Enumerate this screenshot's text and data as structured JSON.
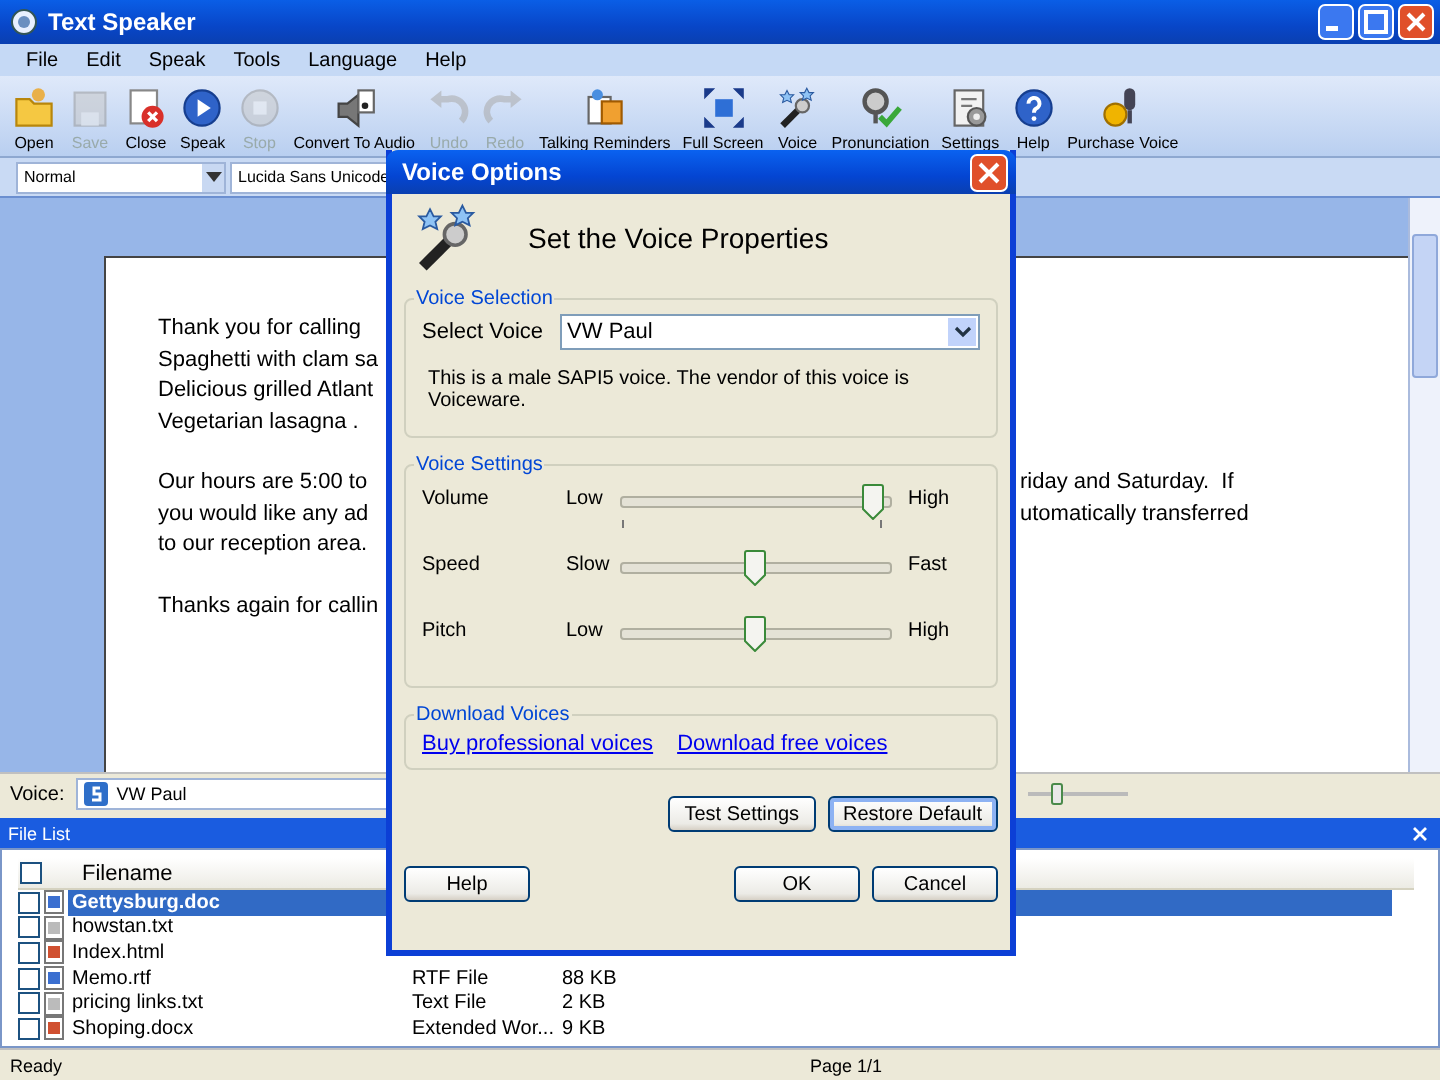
{
  "window": {
    "title": "Text Speaker"
  },
  "menu": [
    "File",
    "Edit",
    "Speak",
    "Tools",
    "Language",
    "Help"
  ],
  "toolbar": [
    {
      "label": "Open",
      "disabled": false
    },
    {
      "label": "Save",
      "disabled": true
    },
    {
      "label": "Close",
      "disabled": false
    },
    {
      "label": "Speak",
      "disabled": false
    },
    {
      "label": "Stop",
      "disabled": true
    },
    {
      "label": "Convert To Audio",
      "disabled": false
    },
    {
      "label": "Undo",
      "disabled": true
    },
    {
      "label": "Redo",
      "disabled": true
    },
    {
      "label": "Talking Reminders",
      "disabled": false
    },
    {
      "label": "Full Screen",
      "disabled": false
    },
    {
      "label": "Voice",
      "disabled": false
    },
    {
      "label": "Pronunciation",
      "disabled": false
    },
    {
      "label": "Settings",
      "disabled": false
    },
    {
      "label": "Help",
      "disabled": false
    },
    {
      "label": "Purchase Voice",
      "disabled": false
    }
  ],
  "format_bar": {
    "style": "Normal",
    "font": "Lucida Sans Unicode"
  },
  "document": {
    "paragraphs": [
      [
        {
          "left": "Thank you for calling"
        },
        {
          "left": "Spaghetti with clam sa"
        },
        {
          "left": "Delicious grilled Atlant"
        },
        {
          "left": "Vegetarian lasagna ."
        }
      ],
      [
        {
          "left": "Our hours are 5:00 to",
          "right": "riday and Saturday.  If"
        },
        {
          "left": "you would like any ad",
          "right": "utomatically transferred"
        },
        {
          "left": "to our reception area."
        }
      ],
      [
        {
          "left": "Thanks again for callin"
        }
      ]
    ]
  },
  "voice_bar": {
    "label": "Voice:",
    "voice": "VW Paul"
  },
  "file_list": {
    "title": "File List",
    "select_all_checked": false,
    "columns": [
      "Filename"
    ],
    "rows": [
      {
        "name": "Gettysburg.doc",
        "kind": "doc",
        "selected": true,
        "checked": false
      },
      {
        "name": "howstan.txt",
        "kind": "txt",
        "selected": false,
        "checked": false
      },
      {
        "name": "Index.html",
        "kind": "html",
        "selected": false,
        "checked": false
      },
      {
        "name": "Memo.rtf",
        "kind": "doc",
        "type": "RTF File",
        "size": "88 KB",
        "selected": false,
        "checked": false
      },
      {
        "name": "pricing links.txt",
        "kind": "txt",
        "type": "Text File",
        "size": "2 KB",
        "selected": false,
        "checked": false
      },
      {
        "name": "Shoping.docx",
        "kind": "html",
        "type": "Extended Wor...",
        "size": "9 KB",
        "selected": false,
        "checked": false
      }
    ]
  },
  "status_bar": {
    "status": "Ready",
    "page": "Page 1/1"
  },
  "dialog": {
    "title": "Voice Options",
    "heading": "Set the Voice Properties",
    "voice_selection": {
      "legend": "Voice Selection",
      "label": "Select Voice",
      "value": "VW Paul",
      "description": "This is a male SAPI5 voice. The vendor of this voice is Voiceware."
    },
    "voice_settings": {
      "legend": "Voice Settings",
      "sliders": [
        {
          "label": "Volume",
          "low": "Low",
          "high": "High",
          "kind": "ticked",
          "level": 1
        },
        {
          "label": "Speed",
          "low": "Slow",
          "high": "Fast",
          "kind": "plain",
          "level": 0.5
        },
        {
          "label": "Pitch",
          "low": "Low",
          "high": "High",
          "kind": "plain",
          "level": 0.5
        }
      ]
    },
    "download": {
      "legend": "Download Voices",
      "links": [
        "Buy professional voices",
        "Download free voices"
      ]
    },
    "actions": [
      {
        "label": "Test Settings",
        "focused": false
      },
      {
        "label": "Restore Default",
        "focused": true
      }
    ],
    "buttons": [
      {
        "label": "Help",
        "focused": false
      },
      {
        "label": "OK",
        "focused": false
      },
      {
        "label": "Cancel",
        "focused": false
      }
    ]
  }
}
